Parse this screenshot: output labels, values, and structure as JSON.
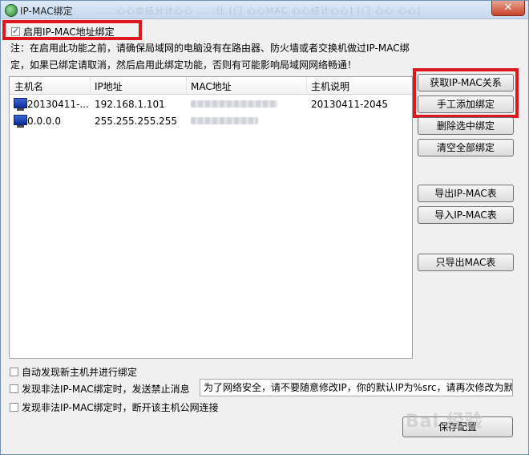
{
  "window": {
    "title": "IP-MAC绑定",
    "title_ghost": "……心心血结分计心心 ……仕  [门 心心MAC 心心结计心心]        [门 心心 心心]",
    "close_glyph": "✕"
  },
  "enable": {
    "label": "启用IP-MAC地址绑定",
    "checked": true
  },
  "note": {
    "line1": "注：在启用此功能之前，请确保局域网的电脑没有在路由器、防火墙或者交换机做过IP-MAC绑",
    "line2": "定，如果已绑定请取消，然后启用此绑定功能，否则有可能影响局域网网络畅通！"
  },
  "table": {
    "columns": [
      "主机名",
      "IP地址",
      "MAC地址",
      "主机说明"
    ],
    "rows": [
      {
        "host": "20130411-...",
        "ip": "192.168.1.101",
        "desc": "20130411-2045"
      },
      {
        "host": "0.0.0.0",
        "ip": "255.255.255.255",
        "desc": ""
      }
    ]
  },
  "buttons": {
    "get_ip_mac": "获取IP-MAC关系",
    "manual_add": "手工添加绑定",
    "delete_selected": "删除选中绑定",
    "clear_all": "清空全部绑定",
    "export_table": "导出IP-MAC表",
    "import_table": "导入IP-MAC表",
    "export_mac_only": "只导出MAC表",
    "save": "保存配置"
  },
  "options": {
    "auto_discover": {
      "label": "自动发现新主机并进行绑定",
      "checked": false
    },
    "send_message": {
      "label": "发现非法IP-MAC绑定时，发送禁止消息",
      "checked": false
    },
    "disconnect": {
      "label": "发现非法IP-MAC绑定时，断开该主机公网连接",
      "checked": false
    }
  },
  "message_text": "为了网络安全，请不要随意修改IP，你的默认IP为%src，请再次修改为默",
  "watermark": "Bai 经验",
  "colors": {
    "highlight": "#e0161e",
    "border": "#6f8fb5"
  }
}
